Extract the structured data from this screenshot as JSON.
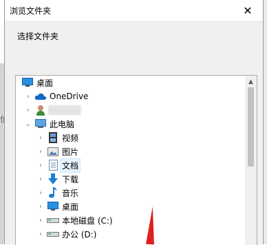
{
  "dialog": {
    "title": "浏览文件夹",
    "close_glyph": "✕",
    "prompt": "选择文件夹"
  },
  "background": {
    "side_text": "位"
  },
  "tree": {
    "items": [
      {
        "label": "桌面",
        "icon": "desktop-icon",
        "level": 0,
        "expander": ""
      },
      {
        "label": "OneDrive",
        "icon": "onedrive-cloud-icon",
        "level": 1,
        "expander": "›"
      },
      {
        "label": "",
        "icon": "user-icon",
        "level": 1,
        "expander": "›"
      },
      {
        "label": "此电脑",
        "icon": "this-pc-icon",
        "level": 1,
        "expander": "⌄"
      },
      {
        "label": "视频",
        "icon": "videos-icon",
        "level": 2,
        "expander": "›"
      },
      {
        "label": "图片",
        "icon": "pictures-icon",
        "level": 2,
        "expander": "›"
      },
      {
        "label": "文档",
        "icon": "documents-icon",
        "level": 2,
        "expander": "›"
      },
      {
        "label": "下载",
        "icon": "downloads-icon",
        "level": 2,
        "expander": "›"
      },
      {
        "label": "音乐",
        "icon": "music-icon",
        "level": 2,
        "expander": "›"
      },
      {
        "label": "桌面",
        "icon": "desktop-icon",
        "level": 2,
        "expander": "›"
      },
      {
        "label": "本地磁盘 (C:)",
        "icon": "drive-icon",
        "level": 2,
        "expander": "›"
      },
      {
        "label": "办公 (D:)",
        "icon": "drive-icon",
        "level": 2,
        "expander": "›"
      }
    ],
    "selected_label": "文档"
  },
  "scrollbar": {
    "up_glyph": "▲"
  },
  "colors": {
    "selection": "#e5f3ff",
    "onedrive": "#0f67c2",
    "folder_blue": "#1e7fd6",
    "arrow": "#e02020"
  }
}
